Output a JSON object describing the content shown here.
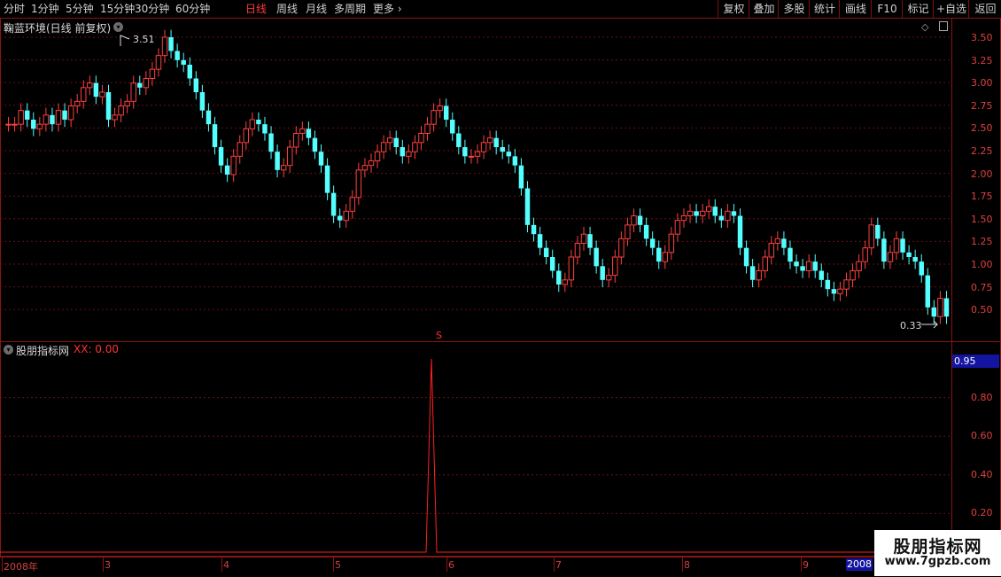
{
  "toolbar": {
    "periods": [
      "分时",
      "1分钟",
      "5分钟",
      "15分钟",
      "30分钟",
      "60分钟",
      "日线",
      "周线",
      "月线",
      "多周期",
      "更多"
    ],
    "active_period": "日线",
    "right_buttons": [
      "复权",
      "叠加",
      "多股",
      "统计",
      "画线",
      "F10",
      "标记",
      "+自选",
      "返回"
    ]
  },
  "main_pane": {
    "title": "鞠蓝环境(日线 前复权)",
    "high_marker": "3.51",
    "low_marker": "0.33",
    "price_axis": [
      "3.50",
      "3.25",
      "3.00",
      "2.75",
      "2.50",
      "2.25",
      "2.00",
      "1.75",
      "1.50",
      "1.25",
      "1.00",
      "0.75",
      "0.50"
    ],
    "signal_marker": "S",
    "colors": {
      "up": "#ff4040",
      "down": "#54ffff",
      "grid": "#6a1010"
    }
  },
  "indicator_pane": {
    "title": "股朋指标网",
    "value_label": "XX: 0.00",
    "current_value_box": "0.95",
    "axis": [
      "0.80",
      "0.60",
      "0.40",
      "0.20"
    ],
    "spike_value": 1.0
  },
  "x_axis": {
    "labels": [
      "2008年",
      "3",
      "4",
      "5",
      "6",
      "7",
      "8",
      "9"
    ],
    "cursor_label": "2008"
  },
  "watermark": {
    "title": "股朋指标网",
    "url": "www.7gpzb.com"
  },
  "chart_data": {
    "type": "candlestick",
    "price_range": [
      0.33,
      3.51
    ],
    "close_trend": [
      2.55,
      2.55,
      2.7,
      2.6,
      2.5,
      2.55,
      2.65,
      2.55,
      2.7,
      2.6,
      2.75,
      2.8,
      2.95,
      3.0,
      2.85,
      2.9,
      2.6,
      2.65,
      2.75,
      2.8,
      3.0,
      2.95,
      3.05,
      3.15,
      3.3,
      3.5,
      3.35,
      3.25,
      3.2,
      3.05,
      2.9,
      2.7,
      2.55,
      2.3,
      2.1,
      2.0,
      2.2,
      2.35,
      2.5,
      2.6,
      2.55,
      2.45,
      2.25,
      2.05,
      2.1,
      2.3,
      2.45,
      2.5,
      2.4,
      2.25,
      2.1,
      1.8,
      1.55,
      1.5,
      1.6,
      1.75,
      2.05,
      2.1,
      2.15,
      2.25,
      2.35,
      2.4,
      2.3,
      2.2,
      2.25,
      2.35,
      2.45,
      2.55,
      2.7,
      2.75,
      2.6,
      2.45,
      2.3,
      2.2,
      2.2,
      2.25,
      2.35,
      2.4,
      2.3,
      2.25,
      2.2,
      2.1,
      1.85,
      1.45,
      1.35,
      1.2,
      1.1,
      0.95,
      0.8,
      0.85,
      1.1,
      1.25,
      1.35,
      1.2,
      1.0,
      0.85,
      0.9,
      1.1,
      1.3,
      1.45,
      1.55,
      1.45,
      1.3,
      1.2,
      1.05,
      1.15,
      1.35,
      1.5,
      1.55,
      1.6,
      1.55,
      1.6,
      1.65,
      1.55,
      1.5,
      1.6,
      1.55,
      1.2,
      1.0,
      0.85,
      0.95,
      1.1,
      1.25,
      1.3,
      1.2,
      1.05,
      1.0,
      0.95,
      1.05,
      0.95,
      0.85,
      0.75,
      0.7,
      0.75,
      0.85,
      0.95,
      1.05,
      1.2,
      1.45,
      1.3,
      1.05,
      1.15,
      1.3,
      1.15,
      1.1,
      1.05,
      0.9,
      0.55,
      0.45,
      0.65,
      0.45
    ],
    "indicator": {
      "spike_index": 0.427,
      "spike_value": 1.0,
      "baseline": 0.0
    }
  }
}
